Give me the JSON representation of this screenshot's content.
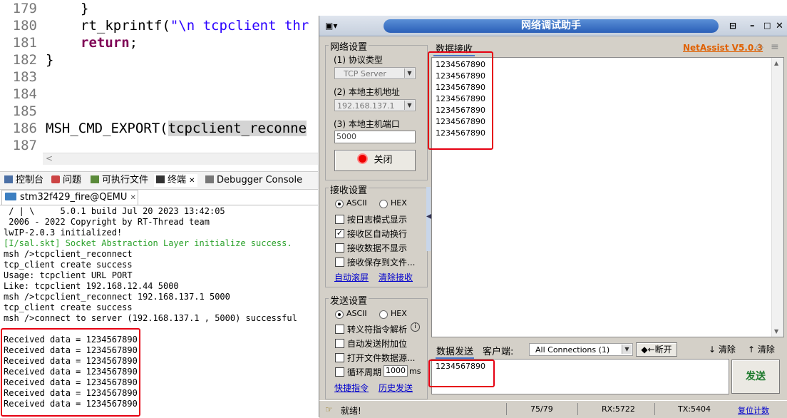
{
  "editor": {
    "lines": [
      {
        "num": "179",
        "indent": "    ",
        "text": "}"
      },
      {
        "num": "180",
        "indent": "    "
      },
      {
        "num": "181",
        "indent": "    "
      },
      {
        "num": "182",
        "indent": "",
        "text": "}"
      },
      {
        "num": "183",
        "text": ""
      },
      {
        "num": "184",
        "text": ""
      },
      {
        "num": "185",
        "text": ""
      },
      {
        "num": "186"
      },
      {
        "num": "187",
        "text": ""
      }
    ],
    "line180_fn": "rt_kprintf(",
    "line180_str": "\"\\n tcpclient thr",
    "line181_kw": "return",
    "line181_rest": ";",
    "line186_macro": "MSH_CMD_EXPORT(",
    "line186_hl": "tcpclient_reconne",
    "scroll_arrow": "<"
  },
  "views": {
    "tabs": [
      "控制台",
      "问题",
      "可执行文件",
      "终端",
      "Debugger Console"
    ],
    "terminal_tab": "stm32f429_fire@QEMU",
    "terminal_close": "✕"
  },
  "terminal": {
    "lines": [
      " / | \\     5.0.1 build Jul 20 2023 13:42:05",
      " 2006 - 2022 Copyright by RT-Thread team",
      "lwIP-2.0.3 initialized!",
      "[I/sal.skt] Socket Abstraction Layer initialize success.",
      "msh />tcpclient_reconnect",
      "tcp_client create success",
      "Usage: tcpclient URL PORT",
      "Like: tcpclient 192.168.12.44 5000",
      "msh />tcpclient_reconnect 192.168.137.1 5000",
      "tcp_client create success",
      "msh />connect to server (192.168.137.1 , 5000) successful",
      "",
      "Received data = 1234567890",
      "Received data = 1234567890",
      "Received data = 1234567890",
      "Received data = 1234567890",
      "Received data = 1234567890",
      "Received data = 1234567890",
      "Received data = 1234567890"
    ]
  },
  "netassist": {
    "title": "网络调试助手",
    "brand": "NetAssist V5.0.3",
    "net_settings": {
      "group": "网络设置",
      "protocol_label": "(1) 协议类型",
      "protocol_value": "TCP Server",
      "host_label": "(2) 本地主机地址",
      "host_value": "192.168.137.1",
      "port_label": "(3) 本地主机端口",
      "port_value": "5000",
      "close_button": "关闭"
    },
    "recv_settings": {
      "group": "接收设置",
      "ascii": "ASCII",
      "hex": "HEX",
      "opts": [
        "按日志模式显示",
        "接收区自动换行",
        "接收数据不显示",
        "接收保存到文件..."
      ],
      "checked": [
        false,
        true,
        false,
        false
      ],
      "auto_scroll": "自动滚屏",
      "clear_recv": "清除接收"
    },
    "send_settings": {
      "group": "发送设置",
      "ascii": "ASCII",
      "hex": "HEX",
      "opts": [
        "转义符指令解析",
        "自动发送附加位",
        "打开文件数据源...",
        "循环周期"
      ],
      "cycle_value": "1000",
      "cycle_unit": "ms",
      "shortcut": "快捷指令",
      "history": "历史发送"
    },
    "recv_tab": "数据接收",
    "recv_data": [
      "1234567890",
      "1234567890",
      "1234567890",
      "1234567890",
      "1234567890",
      "1234567890",
      "1234567890"
    ],
    "send_tab": "数据发送",
    "client_label": "客户端:",
    "client_value": "All Connections (1)",
    "disconnect": "断开",
    "clear1": "清除",
    "clear2": "清除",
    "send_data": "1234567890",
    "send_button": "发送",
    "status": {
      "ready": "就绪!",
      "count": "75/79",
      "rx": "RX:5722",
      "tx": "TX:5404",
      "reset": "复位计数"
    }
  },
  "colors": {
    "highlight_red": "#e60012",
    "title_blue": "#2a5fb8",
    "link_blue": "#0000cc",
    "brand_orange": "#e06000"
  }
}
